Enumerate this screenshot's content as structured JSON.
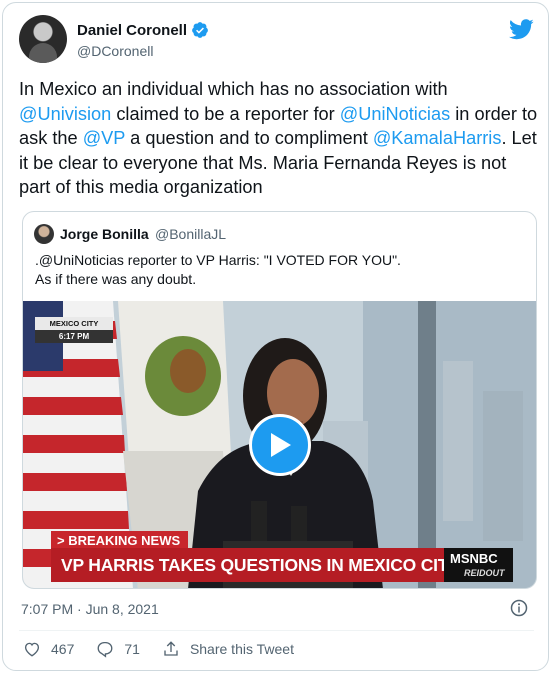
{
  "author": {
    "name": "Daniel Coronell",
    "handle": "@DCoronell"
  },
  "tweet": {
    "t1": "In Mexico an individual which has no association with ",
    "m1": "@Univision",
    "t2": " claimed to be a reporter for ",
    "m2": "@UniNoticias",
    "t3": " in order to ask the ",
    "m3": "@VP",
    "t4": " a question and to compliment ",
    "m4": "@KamalaHarris",
    "t5": ". Let it be clear to everyone that Ms. Maria Fernanda Reyes is not part of this media organization"
  },
  "quoted": {
    "name": "Jorge Bonilla",
    "handle": "@BonillaJL",
    "line1": ".@UniNoticias reporter to VP Harris: \"I VOTED FOR YOU\".",
    "line2": "As if there was any doubt."
  },
  "video": {
    "location": "MEXICO CITY",
    "time": "6:17 PM",
    "breaking": "> BREAKING NEWS",
    "headline": "VP HARRIS TAKES QUESTIONS IN MEXICO CITY",
    "network": "MSNBC",
    "show": "REIDOUT"
  },
  "meta": {
    "timestamp": "7:07 PM · Jun 8, 2021"
  },
  "actions": {
    "likes": "467",
    "replies": "71",
    "share": "Share this Tweet"
  },
  "colors": {
    "accent": "#1d9bf0",
    "breaking_red": "#c8262c"
  }
}
